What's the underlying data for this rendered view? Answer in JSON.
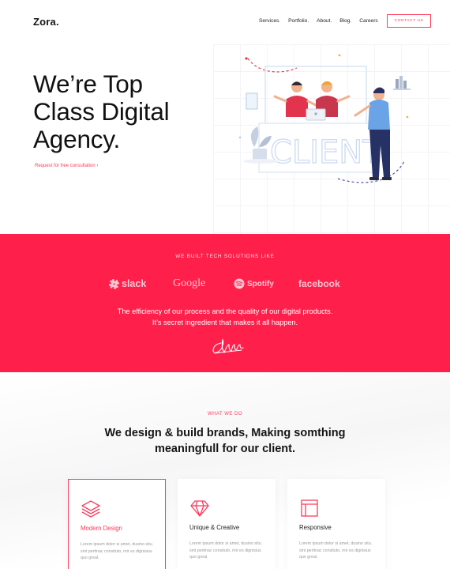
{
  "header": {
    "logo": "Zora.",
    "nav": [
      "Services.",
      "Portfolio.",
      "About.",
      "Blog.",
      "Careers"
    ],
    "contact_label": "CONTACT US"
  },
  "hero": {
    "title_lines": [
      "We’re Top",
      "Class Digital",
      "Agency."
    ],
    "link_label": "Request for free consultation ›",
    "illustration_word": "CLIENT"
  },
  "band": {
    "eyebrow": "WE BUILT TECH SOLUTIONS LIKE",
    "brands": [
      "slack",
      "Google",
      "Spotify",
      "facebook"
    ],
    "text_line1": "The efficiency of our process and the quality of our digital products.",
    "text_line2": "It’s secret ingredient that makes it all happen."
  },
  "services": {
    "eyebrow": "WHAT WE DO",
    "title_line1": "We design & build brands, Making somthing",
    "title_line2": "meaningfull for our client.",
    "cards": [
      {
        "title": "Modern Design",
        "text": "Lorem ipsum dolor si amet, dusino situ. sint pertinac consituto, mir es dignisius quo greal.",
        "icon": "layers-icon"
      },
      {
        "title": "Unique & Creative",
        "text": "Lorem ipsum dolor si amet, dusino situ. sint pertinac consituto, mir es dignisius quo greal.",
        "icon": "diamond-icon"
      },
      {
        "title": "Responsive",
        "text": "Lorem ipsum dolor si amet, dusino situ. sint pertinac consituto, mir es dignisius quo greal.",
        "icon": "window-icon"
      }
    ]
  },
  "colors": {
    "accent": "#ff1f4b",
    "accent_text": "#ff3b5c"
  }
}
